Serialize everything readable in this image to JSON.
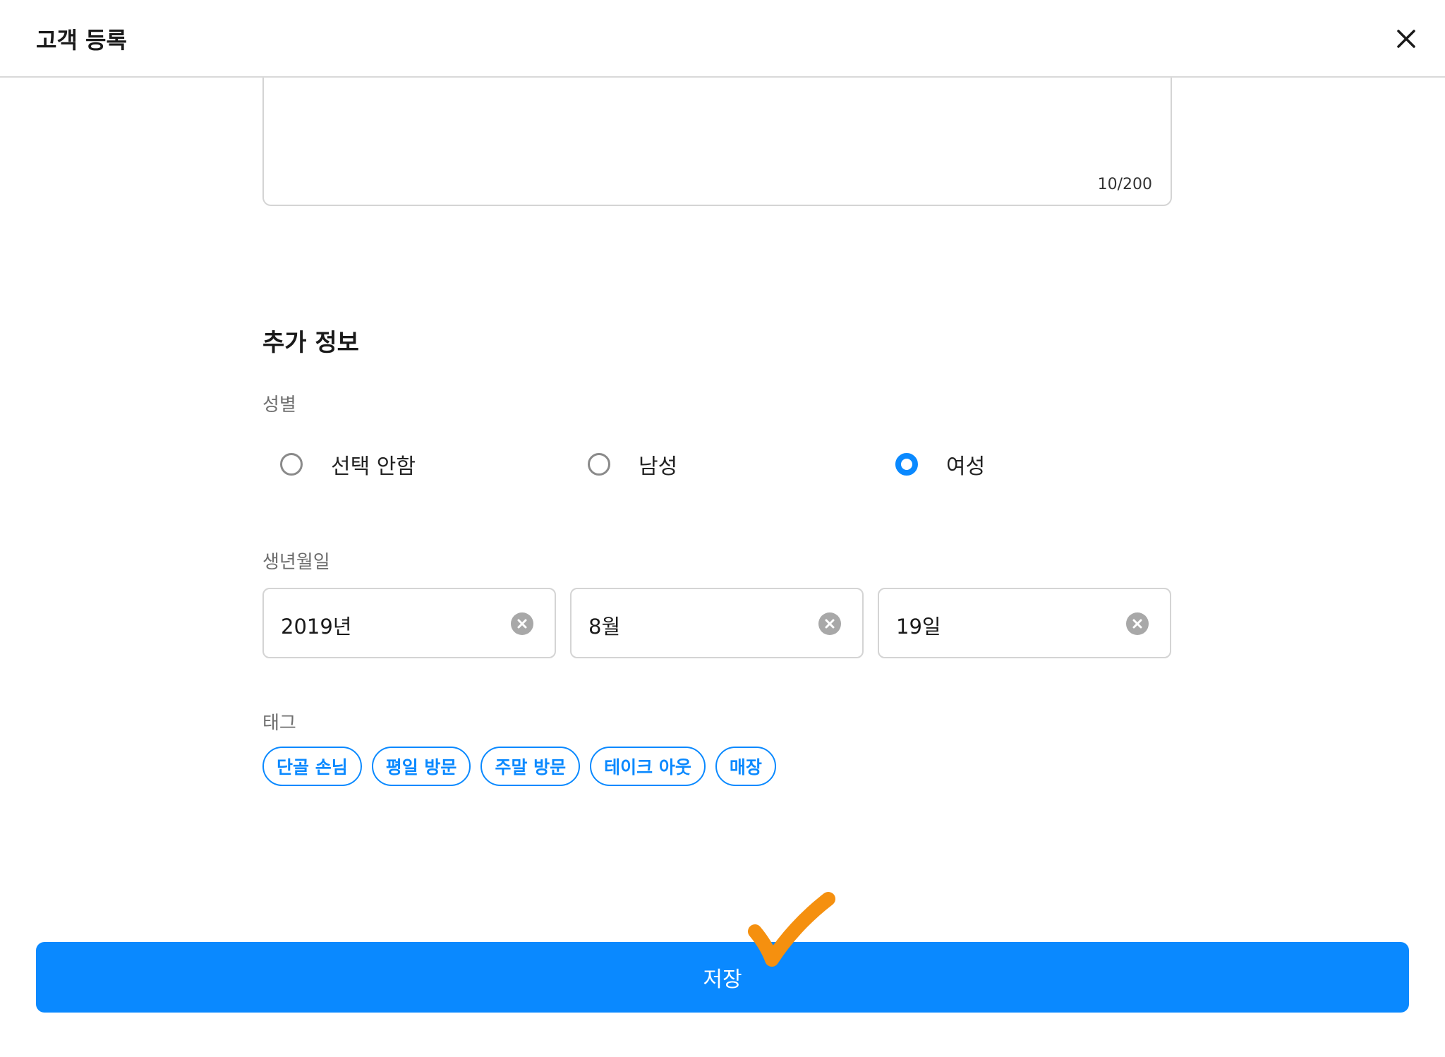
{
  "header": {
    "title": "고객 등록",
    "close_icon": "close-icon"
  },
  "memo": {
    "char_count": "10/200"
  },
  "additional_info": {
    "section_title": "추가 정보",
    "gender": {
      "label": "성별",
      "options": [
        "선택 안함",
        "남성",
        "여성"
      ],
      "selected": "여성"
    },
    "birthdate": {
      "label": "생년월일",
      "year": "2019년",
      "month": "8월",
      "day": "19일"
    },
    "tags": {
      "label": "태그",
      "items": [
        "단골 손님",
        "평일 방문",
        "주말 방문",
        "테이크 아웃",
        "매장"
      ]
    }
  },
  "save_button": {
    "label": "저장"
  },
  "colors": {
    "accent": "#0a89ff",
    "annotation": "#f5900f"
  }
}
